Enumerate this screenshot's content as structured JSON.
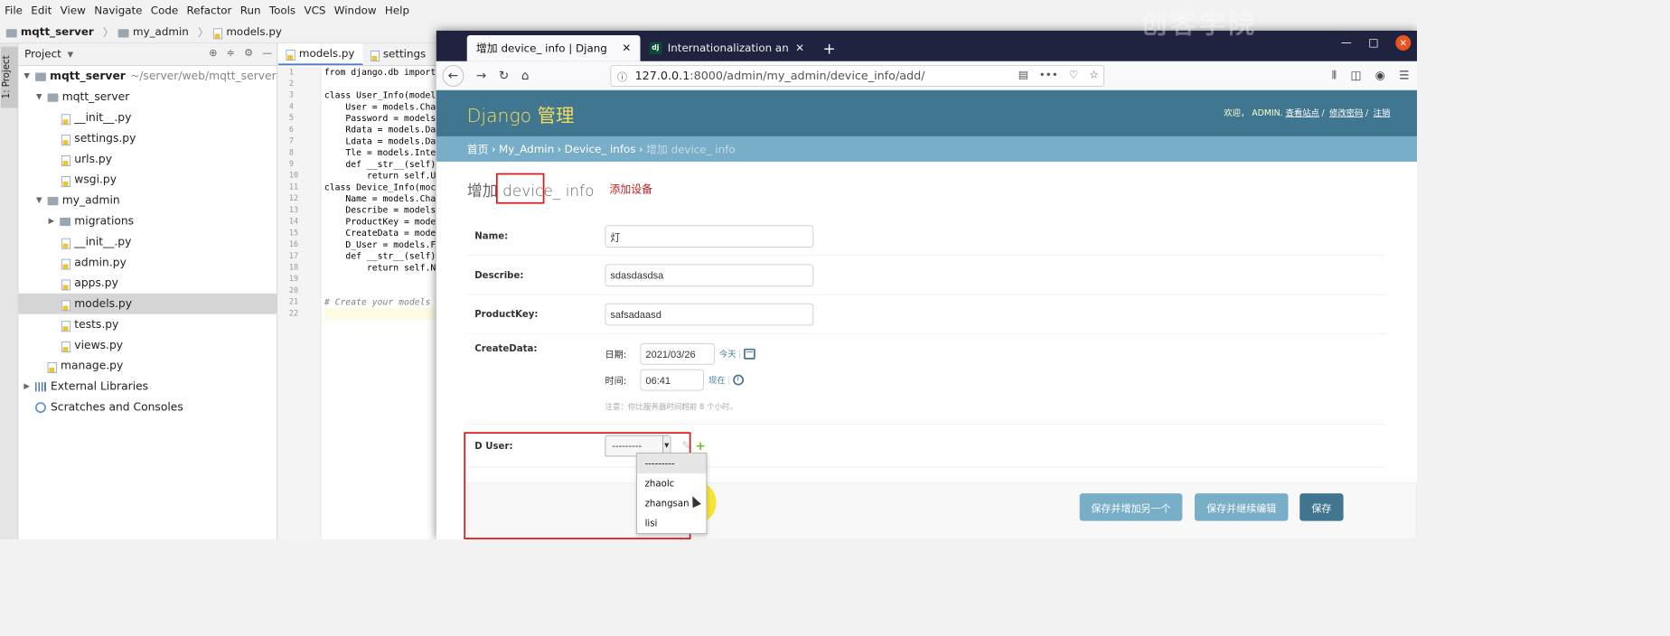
{
  "ide": {
    "menu": [
      "File",
      "Edit",
      "View",
      "Navigate",
      "Code",
      "Refactor",
      "Run",
      "Tools",
      "VCS",
      "Window",
      "Help"
    ],
    "breadcrumb": [
      "mqtt_server",
      "my_admin",
      "models.py"
    ],
    "side_tab": "1: Project",
    "project_panel_title": "Project",
    "tree": [
      {
        "label": "mqtt_server",
        "path": "~/server/web/mqtt_server"
      },
      {
        "label": "mqtt_server"
      },
      {
        "label": "__init__.py"
      },
      {
        "label": "settings.py"
      },
      {
        "label": "urls.py"
      },
      {
        "label": "wsgi.py"
      },
      {
        "label": "my_admin"
      },
      {
        "label": "migrations"
      },
      {
        "label": "__init__.py"
      },
      {
        "label": "admin.py"
      },
      {
        "label": "apps.py"
      },
      {
        "label": "models.py"
      },
      {
        "label": "tests.py"
      },
      {
        "label": "views.py"
      },
      {
        "label": "manage.py"
      },
      {
        "label": "External Libraries"
      },
      {
        "label": "Scratches and Consoles"
      }
    ],
    "editor_tabs": [
      "models.py",
      "settings"
    ],
    "line_numbers": [
      "1",
      "2",
      "3",
      "4",
      "5",
      "6",
      "7",
      "8",
      "9",
      "10",
      "11",
      "12",
      "13",
      "14",
      "15",
      "16",
      "17",
      "18",
      "19",
      "20",
      "21",
      "22"
    ],
    "code_lines": [
      "from django.db import",
      "",
      "class User_Info(model",
      "    User = models.Cha",
      "    Password = models",
      "    Rdata = models.Da",
      "    Ldata = models.Da",
      "    Tle = models.Inte",
      "    def __str__(self)",
      "        return self.U",
      "class Device_Info(moc",
      "    Name = models.Cha",
      "    Describe = models",
      "    ProductKey = mode",
      "    CreateData = mode",
      "    D_User = models.F",
      "    def __str__(self)",
      "        return self.N",
      "",
      "",
      "# Create your models",
      ""
    ]
  },
  "browser": {
    "tabs": [
      "增加 device_ info | Django 站",
      "Internationalization and"
    ],
    "url_host": "127.0.0.1",
    "url_path": ":8000/admin/my_admin/device_info/add/"
  },
  "django": {
    "brand": "Django 管理",
    "welcome": "欢迎，",
    "user": "ADMIN.",
    "view_site": "查看站点",
    "change_password": "修改密码",
    "logout": "注销",
    "breadcrumbs": [
      "首页",
      "My_Admin",
      "Device_ infos",
      "增加 device_ info"
    ],
    "title": "增加 device_ info",
    "annotation": "添加设备",
    "fields": {
      "name_label": "Name:",
      "name_value": "灯",
      "describe_label": "Describe:",
      "describe_value": "sdasdasdsa",
      "productkey_label": "ProductKey:",
      "productkey_value": "safsadaasd",
      "createdata_label": "CreateData:",
      "date_label": "日期:",
      "date_value": "2021/03/26",
      "today_link": "今天",
      "time_label": "时间:",
      "time_value": "06:41",
      "now_link": "现在",
      "tz_note": "注意：你比服务器时间超前 8 个小时。",
      "duser_label": "D User:",
      "duser_selected": "---------",
      "duser_options": [
        "---------",
        "zhaolc",
        "zhangsan",
        "lisi"
      ]
    },
    "buttons": {
      "save_add": "保存并增加另一个",
      "save_continue": "保存并继续编辑",
      "save": "保存"
    }
  },
  "watermark": "创客学院",
  "colors": {
    "header": "#417690",
    "breadcrumbs": "#79aec8",
    "brand": "#f5dd5d",
    "annotation": "#e01414"
  }
}
